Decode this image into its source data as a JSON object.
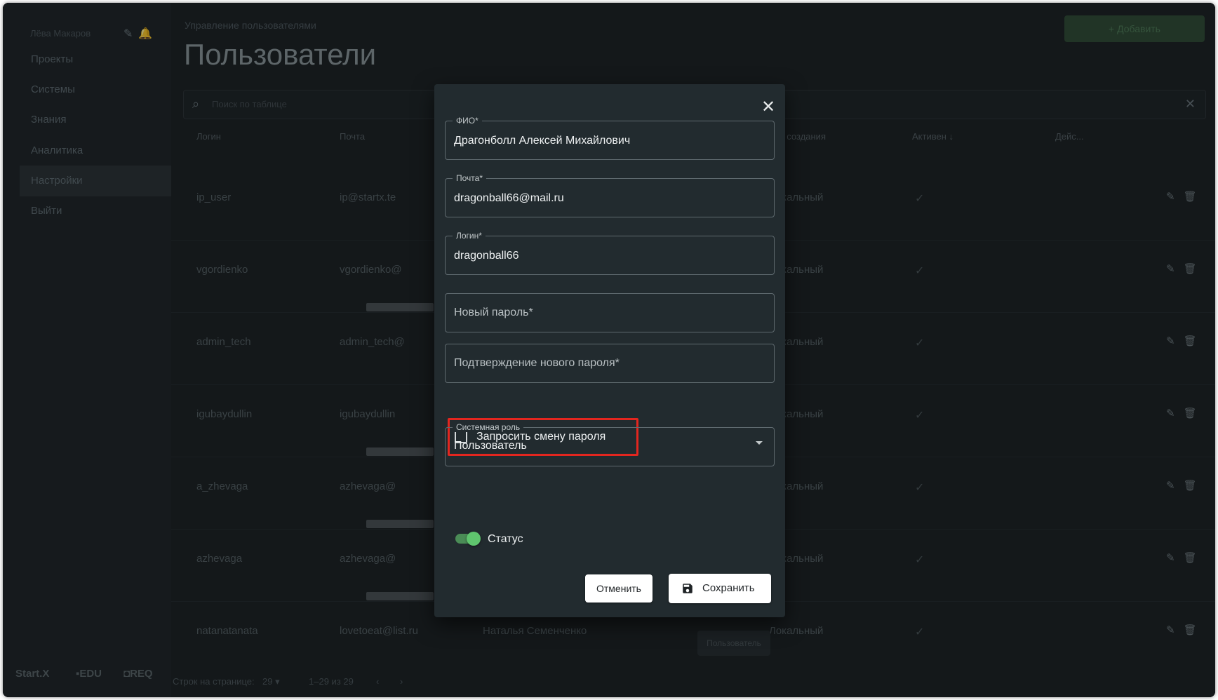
{
  "sidebar": {
    "user_name": "Лёва Макаров",
    "items": [
      {
        "label": "Проекты"
      },
      {
        "label": "Системы"
      },
      {
        "label": "Знания"
      },
      {
        "label": "Аналитика"
      },
      {
        "label": "Настройки"
      },
      {
        "label": "Выйти"
      }
    ],
    "active_item": "Настройки",
    "footer": {
      "brand": "Start.X",
      "edu": "EDU",
      "req": "REQ"
    }
  },
  "header": {
    "breadcrumb": "Управление пользователями",
    "title": "Пользователи",
    "add_button": "+ Добавить"
  },
  "search": {
    "placeholder": "Поиск по таблице"
  },
  "table": {
    "columns": [
      "Логин",
      "Почта",
      "Тип создания",
      "Активен",
      "Дейс..."
    ],
    "rows": [
      {
        "login": "ip_user",
        "email": "ip@startx.te",
        "type": "Локальный",
        "active": "✓"
      },
      {
        "login": "vgordienko",
        "email": "vgordienko@",
        "type": "Локальный",
        "active": "✓"
      },
      {
        "login": "admin_tech",
        "email": "admin_tech@",
        "type": "Локальный",
        "active": "✓"
      },
      {
        "login": "igubaydullin",
        "email": "igubaydullin",
        "type": "Локальный",
        "active": "✓"
      },
      {
        "login": "a_zhevaga",
        "email": "azhevaga@",
        "type": "Локальный",
        "active": "✓"
      },
      {
        "login": "azhevaga",
        "email": "azhevaga@",
        "type": "Локальный",
        "active": "✓"
      },
      {
        "login": "natanatanata",
        "email": "lovetoeat@list.ru",
        "name": "Наталья Семенченко",
        "role": "Пользователь",
        "type": "Локальный",
        "active": "✓"
      }
    ]
  },
  "pagination": {
    "rows_per_page_label": "Строк на странице:",
    "rows_per_page": "29 ▾",
    "range": "1–29 из 29",
    "prev": "‹",
    "next": "›"
  },
  "modal": {
    "fio": {
      "label": "ФИО*",
      "value": "Драгонболл Алексей Михайлович"
    },
    "email": {
      "label": "Почта*",
      "value": "dragonball66@mail.ru"
    },
    "login": {
      "label": "Логин*",
      "value": "dragonball66"
    },
    "new_password": {
      "placeholder": "Новый пароль*"
    },
    "confirm_password": {
      "placeholder": "Подтверждение нового пароля*"
    },
    "request_change": {
      "label": "Запросить смену пароля",
      "checked": false
    },
    "role": {
      "label": "Системная роль",
      "value": "Пользователь"
    },
    "status": {
      "label": "Статус",
      "on": true
    },
    "cancel": "Отменить",
    "save": "Сохранить"
  },
  "colors": {
    "accent_green": "#5fc56e",
    "highlight_red": "#e3261f",
    "modal_bg": "#222b2f"
  }
}
